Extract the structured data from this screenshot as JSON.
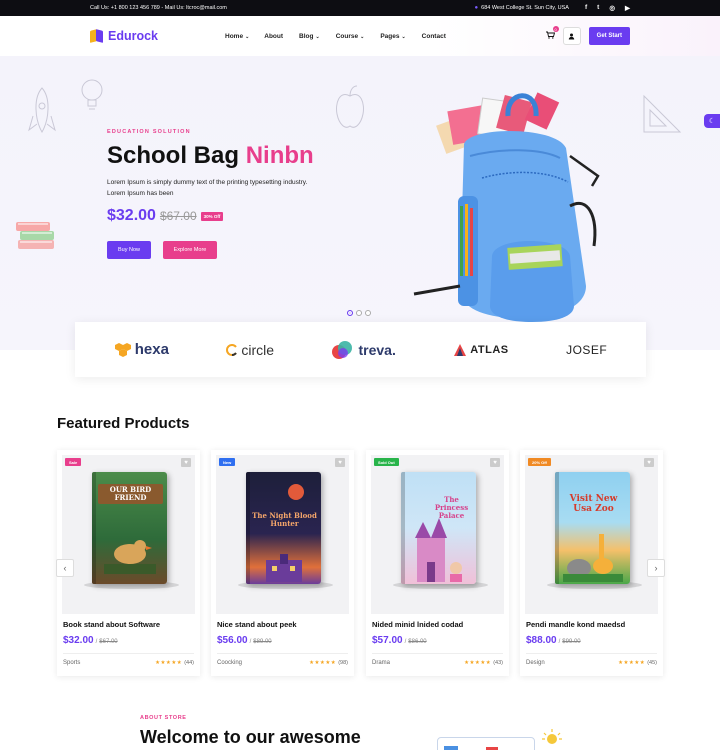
{
  "topbar": {
    "contact": "Call Us: +1 800 123 456 789 - Mail Us: ltcroc@mail.com",
    "address": "684 West College St. Sun City, USA",
    "social": [
      "f",
      "t",
      "ig",
      "yt"
    ]
  },
  "header": {
    "logo": "Edurock",
    "nav": [
      {
        "label": "Home",
        "dropdown": true
      },
      {
        "label": "About",
        "dropdown": false
      },
      {
        "label": "Blog",
        "dropdown": true
      },
      {
        "label": "Course",
        "dropdown": true
      },
      {
        "label": "Pages",
        "dropdown": true
      },
      {
        "label": "Contact",
        "dropdown": false
      }
    ],
    "cart_count": "0",
    "cta": "Get Start"
  },
  "hero": {
    "eyebrow": "EDUCATION SOLUTION",
    "title_main": "School Bag",
    "title_accent": "Ninbn",
    "description": "Lorem Ipsum is simply dummy text of the printing typesetting industry. Lorem Ipsum has been",
    "price": "$32.00",
    "old_price": "$67.00",
    "off_badge": "30% Off",
    "buy_label": "Buy Now",
    "explore_label": "Explore More",
    "slides": 3,
    "active_slide": 0
  },
  "brands": [
    "hexa",
    "circle",
    "treva.",
    "ATLAS",
    "JOSEF"
  ],
  "featured": {
    "title": "Featured Products",
    "products": [
      {
        "badge": "Sale",
        "badge_color": "#e83e8c",
        "book_title": "OUR BIRD FRIEND",
        "name": "Book stand about Software",
        "price": "$32.00",
        "old_price": "$67.00",
        "category": "Sports",
        "reviews": "(44)",
        "stars": "★★★★★"
      },
      {
        "badge": "New",
        "badge_color": "#2f6ff0",
        "book_title": "The Night Blood Hunter",
        "name": "Nice stand about peek",
        "price": "$56.00",
        "old_price": "$89.00",
        "category": "Coocking",
        "reviews": "(98)",
        "stars": "★★★★★"
      },
      {
        "badge": "Sold Out",
        "badge_color": "#28b44a",
        "book_title": "The Princess Palace",
        "name": "Nided minid lnided codad",
        "price": "$57.00",
        "old_price": "$86.00",
        "category": "Drama",
        "reviews": "(43)",
        "stars": "★★★★★"
      },
      {
        "badge": "20% Off",
        "badge_color": "#f08a24",
        "book_title": "Visit New Usa Zoo",
        "name": "Pendi mandle kond maedsd",
        "price": "$88.00",
        "old_price": "$99.00",
        "category": "Design",
        "reviews": "(45)",
        "stars": "★★★★★"
      }
    ]
  },
  "about": {
    "eyebrow": "ABOUT STORE",
    "title": "Welcome to our awesome"
  }
}
